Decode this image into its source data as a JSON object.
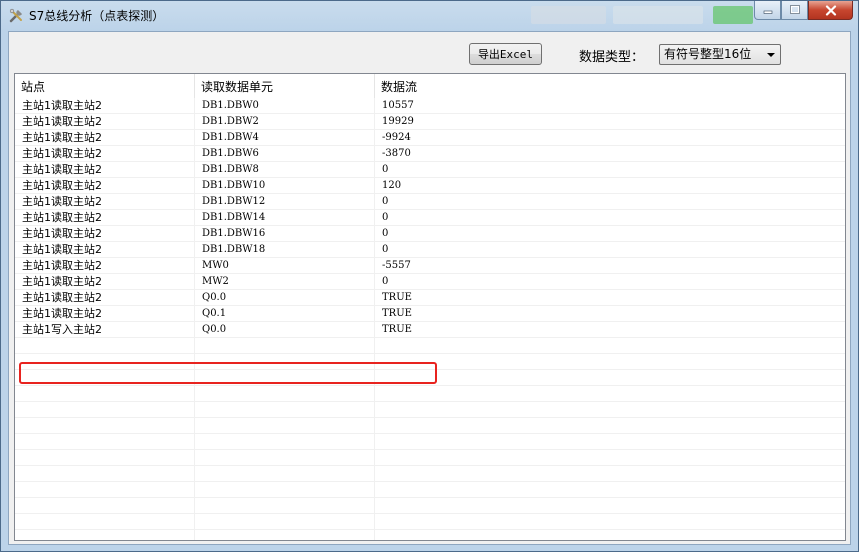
{
  "window": {
    "title": "S7总线分析（点表探测）",
    "controls": {
      "minimize": "—",
      "maximize": "□",
      "close": "✕"
    }
  },
  "toolbar": {
    "export_label": "导出Excel",
    "data_type_label": "数据类型：",
    "data_type_value": "有符号整型16位"
  },
  "table": {
    "columns": [
      "站点",
      "读取数据单元",
      "数据流"
    ],
    "rows": [
      [
        "主站1读取主站2",
        "DB1.DBW0",
        "10557"
      ],
      [
        "主站1读取主站2",
        "DB1.DBW2",
        "19929"
      ],
      [
        "主站1读取主站2",
        "DB1.DBW4",
        "-9924"
      ],
      [
        "主站1读取主站2",
        "DB1.DBW6",
        "-3870"
      ],
      [
        "主站1读取主站2",
        "DB1.DBW8",
        "0"
      ],
      [
        "主站1读取主站2",
        "DB1.DBW10",
        "120"
      ],
      [
        "主站1读取主站2",
        "DB1.DBW12",
        "0"
      ],
      [
        "主站1读取主站2",
        "DB1.DBW14",
        "0"
      ],
      [
        "主站1读取主站2",
        "DB1.DBW16",
        "0"
      ],
      [
        "主站1读取主站2",
        "DB1.DBW18",
        "0"
      ],
      [
        "主站1读取主站2",
        "MW0",
        "-5557"
      ],
      [
        "主站1读取主站2",
        "MW2",
        "0"
      ],
      [
        "主站1读取主站2",
        "Q0.0",
        "TRUE"
      ],
      [
        "主站1读取主站2",
        "Q0.1",
        "TRUE"
      ],
      [
        "主站1写入主站2",
        "Q0.0",
        "TRUE"
      ]
    ],
    "highlighted_row": 15
  },
  "colors": {
    "highlight": "#e8231f",
    "title_bg": "#bcd3e9"
  }
}
